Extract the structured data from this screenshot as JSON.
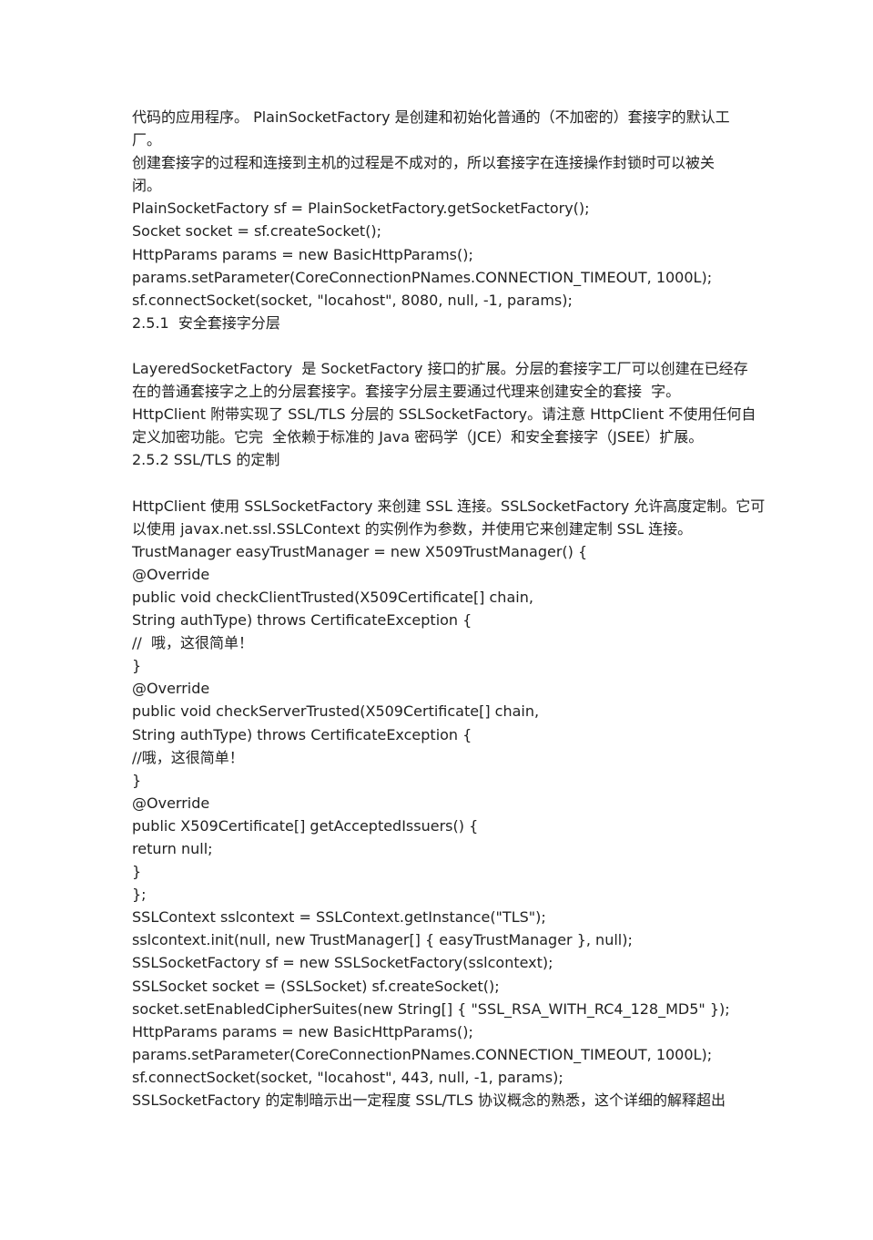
{
  "document": {
    "lines": [
      "代码的应用程序。 PlainSocketFactory 是创建和初始化普通的（不加密的）套接字的默认工",
      "厂。",
      "创建套接字的过程和连接到主机的过程是不成对的，所以套接字在连接操作封锁时可以被关",
      "闭。",
      "PlainSocketFactory sf = PlainSocketFactory.getSocketFactory();",
      "Socket socket = sf.createSocket();",
      "HttpParams params = new BasicHttpParams();",
      "params.setParameter(CoreConnectionPNames.CONNECTION_TIMEOUT, 1000L);",
      "sf.connectSocket(socket, \"locahost\", 8080, null, -1, params);",
      "2.5.1  安全套接字分层",
      "",
      "LayeredSocketFactory  是 SocketFactory 接口的扩展。分层的套接字工厂可以创建在已经存",
      "在的普通套接字之上的分层套接字。套接字分层主要通过代理来创建安全的套接  字。",
      "HttpClient 附带实现了 SSL/TLS 分层的 SSLSocketFactory。请注意 HttpClient 不使用任何自",
      "定义加密功能。它完  全依赖于标准的 Java 密码学（JCE）和安全套接字（JSEE）扩展。",
      "2.5.2 SSL/TLS 的定制",
      "",
      "HttpClient 使用 SSLSocketFactory 来创建 SSL 连接。SSLSocketFactory 允许高度定制。它可",
      "以使用 javax.net.ssl.SSLContext 的实例作为参数，并使用它来创建定制 SSL 连接。",
      "TrustManager easyTrustManager = new X509TrustManager() {",
      "@Override",
      "public void checkClientTrusted(X509Certificate[] chain,",
      "String authType) throws CertificateException {",
      "//  哦，这很简单！",
      "}",
      "@Override",
      "public void checkServerTrusted(X509Certificate[] chain,",
      "String authType) throws CertificateException {",
      "//哦，这很简单！",
      "}",
      "@Override",
      "public X509Certificate[] getAcceptedIssuers() {",
      "return null;",
      "}",
      "};",
      "SSLContext sslcontext = SSLContext.getInstance(\"TLS\");",
      "sslcontext.init(null, new TrustManager[] { easyTrustManager }, null);",
      "SSLSocketFactory sf = new SSLSocketFactory(sslcontext);",
      "SSLSocket socket = (SSLSocket) sf.createSocket();",
      "socket.setEnabledCipherSuites(new String[] { \"SSL_RSA_WITH_RC4_128_MD5\" });",
      "HttpParams params = new BasicHttpParams();",
      "params.setParameter(CoreConnectionPNames.CONNECTION_TIMEOUT, 1000L);",
      "sf.connectSocket(socket, \"locahost\", 443, null, -1, params);",
      "SSLSocketFactory 的定制暗示出一定程度 SSL/TLS 协议概念的熟悉，这个详细的解释超出"
    ]
  }
}
